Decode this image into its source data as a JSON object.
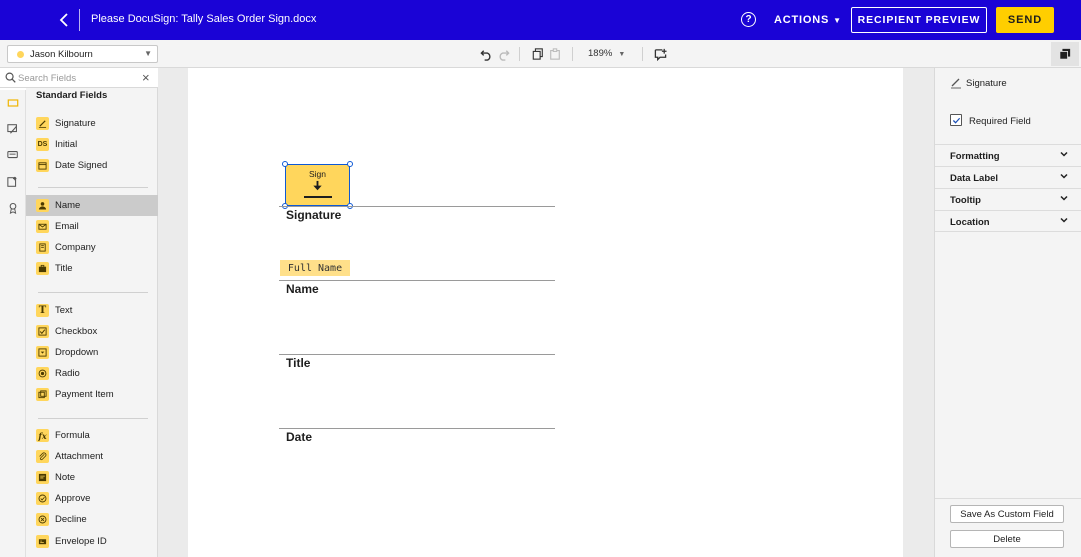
{
  "header": {
    "document_title": "Please DocuSign: Tally Sales Order Sign.docx",
    "help_glyph": "?",
    "actions_label": "ACTIONS",
    "recipient_preview_label": "RECIPIENT PREVIEW",
    "send_label": "SEND",
    "bar_color": "#1a03d6",
    "send_color": "#ffce00"
  },
  "toolbar": {
    "recipient_name": "Jason Kilbourn",
    "recipient_color": "#ffd65c",
    "zoom": "189%"
  },
  "search": {
    "placeholder": "Search Fields"
  },
  "fields_panel": {
    "group_title": "Standard Fields",
    "items": [
      {
        "label": "Signature",
        "icon": "signature-icon"
      },
      {
        "label": "Initial",
        "icon": "initial-icon",
        "glyph": "DS"
      },
      {
        "label": "Date Signed",
        "icon": "calendar-icon"
      },
      {
        "label": "Name",
        "icon": "person-icon",
        "active": true
      },
      {
        "label": "Email",
        "icon": "envelope-icon"
      },
      {
        "label": "Company",
        "icon": "building-icon"
      },
      {
        "label": "Title",
        "icon": "briefcase-icon"
      },
      {
        "label": "Text",
        "icon": "text-icon",
        "glyph": "T"
      },
      {
        "label": "Checkbox",
        "icon": "checkbox-icon"
      },
      {
        "label": "Dropdown",
        "icon": "dropdown-icon"
      },
      {
        "label": "Radio",
        "icon": "radio-icon"
      },
      {
        "label": "Payment Item",
        "icon": "payment-icon"
      },
      {
        "label": "Formula",
        "icon": "formula-icon",
        "glyph": "fx"
      },
      {
        "label": "Attachment",
        "icon": "paperclip-icon"
      },
      {
        "label": "Note",
        "icon": "note-icon"
      },
      {
        "label": "Approve",
        "icon": "approve-icon"
      },
      {
        "label": "Decline",
        "icon": "decline-icon"
      },
      {
        "label": "Envelope ID",
        "icon": "envelope-id-icon"
      }
    ]
  },
  "document": {
    "sign_tag_label": "Sign",
    "signature_label": "Signature",
    "full_name_tag": "Full Name",
    "name_label": "Name",
    "title_label": "Title",
    "date_label": "Date"
  },
  "properties_panel": {
    "field_type": "Signature",
    "required_label": "Required Field",
    "required_checked": true,
    "sections": [
      "Formatting",
      "Data Label",
      "Tooltip",
      "Location"
    ],
    "save_custom_label": "Save As Custom Field",
    "delete_label": "Delete"
  }
}
